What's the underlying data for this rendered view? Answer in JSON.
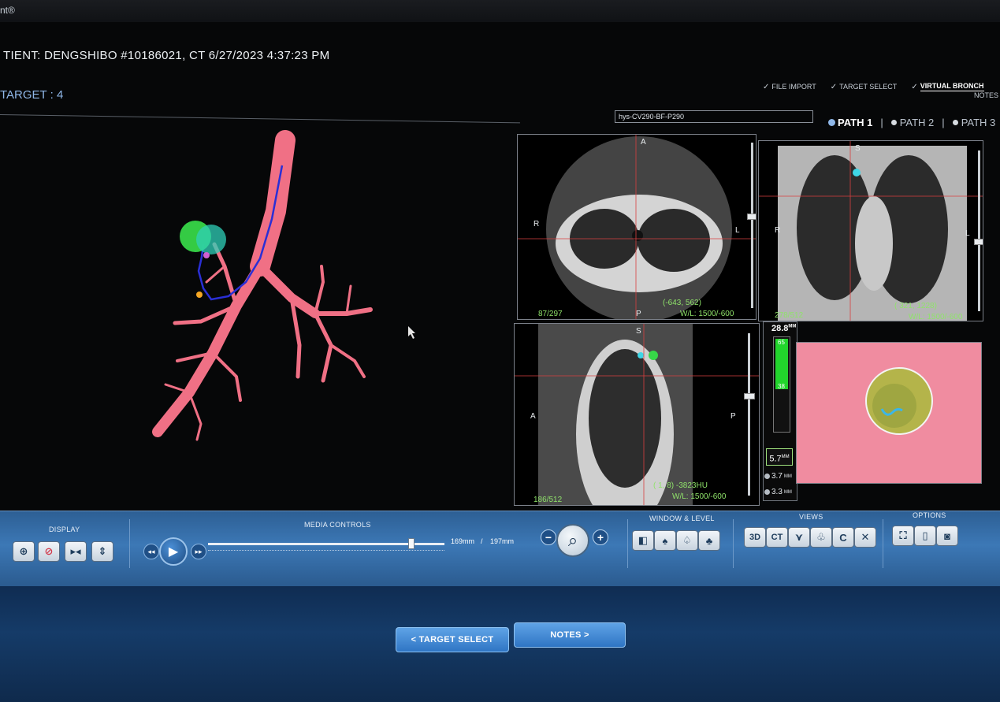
{
  "header": {
    "app_mark": "nt®",
    "patient_line": "TIENT:   DENGSHIBO #10186021, CT 6/27/2023 4:37:23 PM",
    "target_line": "TARGET : 4"
  },
  "steps": [
    {
      "label": "FILE IMPORT",
      "checked": true,
      "active": false
    },
    {
      "label": "TARGET SELECT",
      "checked": true,
      "active": false
    },
    {
      "label": "VIRTUAL BRONCH",
      "checked": true,
      "active": true
    }
  ],
  "notes_link": "NOTES",
  "scope_field": "hys-CV290-BF-P290",
  "paths": [
    {
      "label": "PATH 1",
      "active": true
    },
    {
      "label": "PATH 2",
      "active": false
    },
    {
      "label": "PATH 3",
      "active": false
    }
  ],
  "views": {
    "axial": {
      "top": "A",
      "left": "R",
      "right": "L",
      "bottom": "P",
      "slice": "87/297",
      "coord": "(-643, 562)",
      "wl": "W/L: 1500/-600"
    },
    "coronal": {
      "top": "S",
      "left": "R",
      "right": "L",
      "slice": "278/512",
      "coord": "( 321, 1228)",
      "wl": "W/L: 1500/-600"
    },
    "sagittal": {
      "top": "S",
      "left": "A",
      "right": "P",
      "slice": "186/512",
      "coord": "( 1, 8) -3823HU",
      "wl": "W/L: 1500/-600"
    }
  },
  "meter": {
    "top_value": "28.8",
    "unit": "MM",
    "bar_high": "65",
    "bar_low": "38",
    "fill_fraction": 0.55,
    "box_value": "5.7",
    "row1": "3.7",
    "row2": "3.3"
  },
  "toolbar": {
    "display_title": "DISPLAY",
    "media_title": "MEDIA CONTROLS",
    "window_title": "WINDOW & LEVEL",
    "views_title": "VIEWS",
    "options_title": "OPTIONS",
    "media_current": "169mm",
    "media_sep": "/",
    "media_total": "197mm",
    "media_progress": 0.86,
    "views_3d": "3D",
    "views_ct": "CT"
  },
  "footer": {
    "back_label": "< TARGET SELECT",
    "next_label": "NOTES >"
  },
  "colors": {
    "airway": "#f07085",
    "path": "#2a2fd6",
    "target": "#37d648",
    "toolbar": "#3c78b6",
    "accent": "#8fb7e8",
    "info_text": "#8fe36a"
  }
}
